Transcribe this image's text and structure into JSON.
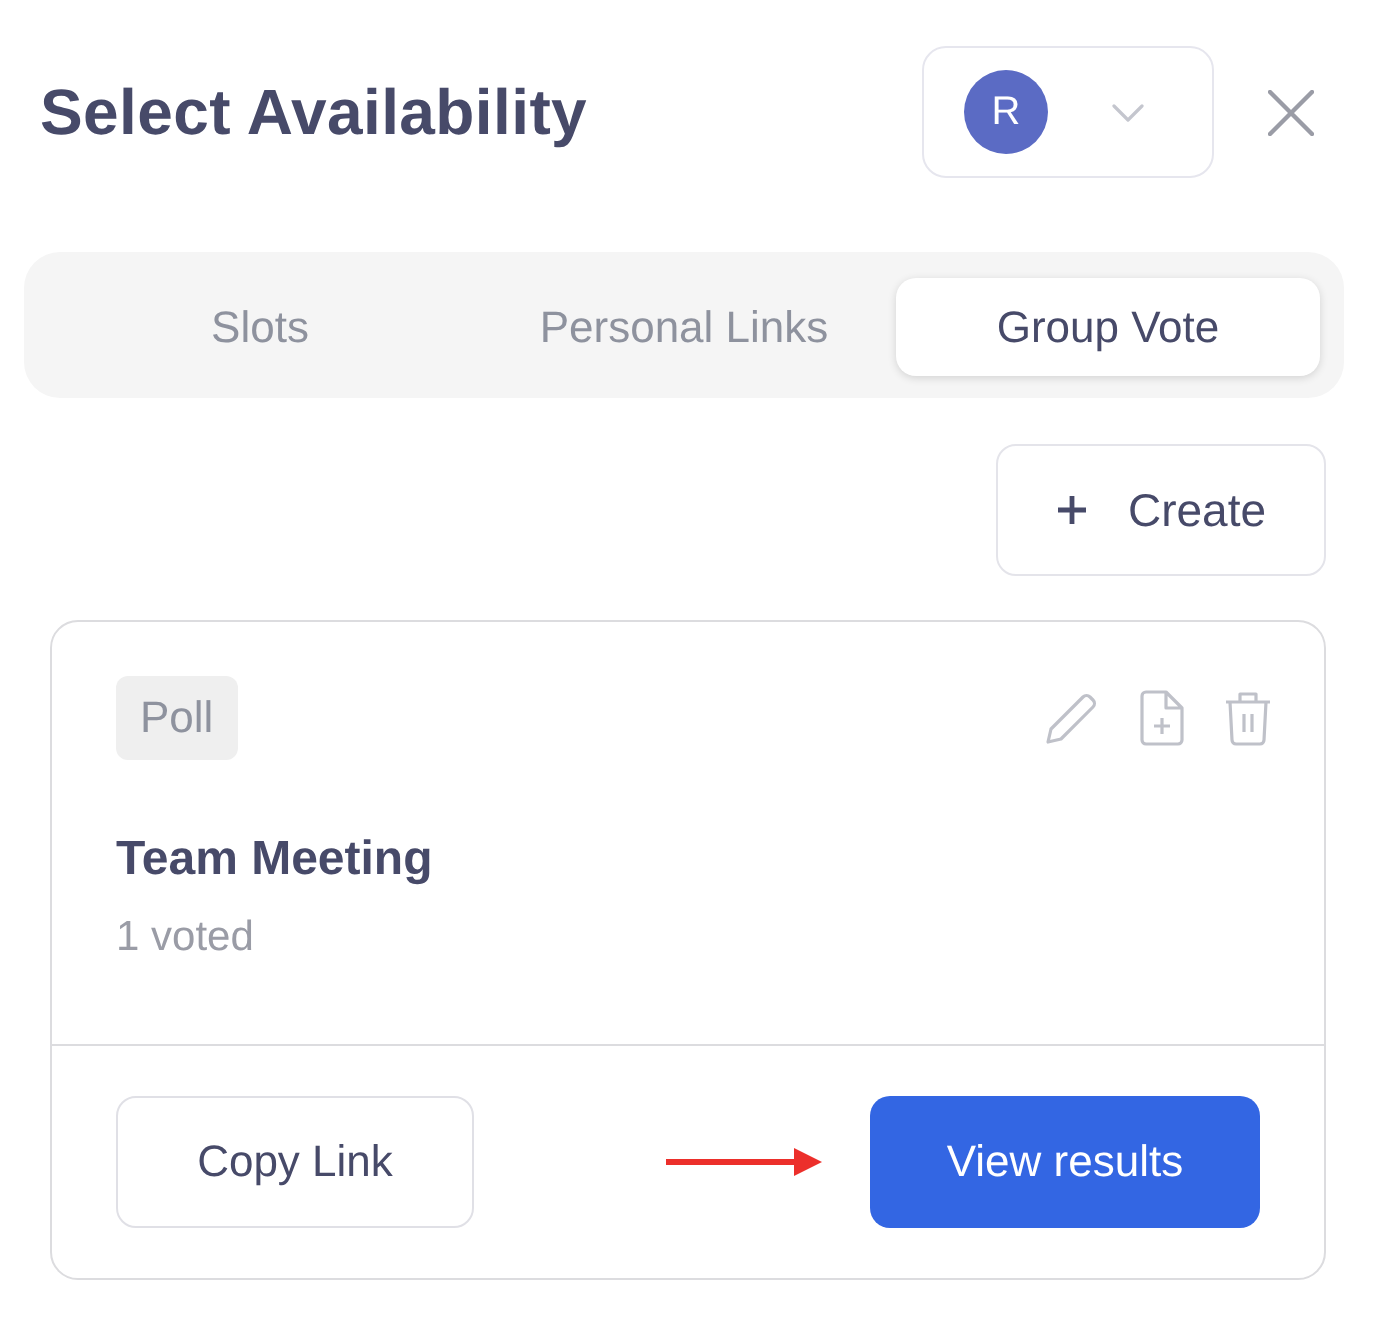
{
  "header": {
    "title": "Select Availability",
    "account": {
      "initial": "R"
    }
  },
  "tabs": [
    {
      "label": "Slots",
      "selected": false
    },
    {
      "label": "Personal Links",
      "selected": false
    },
    {
      "label": "Group Vote",
      "selected": true
    }
  ],
  "create_button": {
    "label": "Create"
  },
  "polls": [
    {
      "tag": "Poll",
      "title": "Team Meeting",
      "votes": "1 voted",
      "copy_button": "Copy Link",
      "view_button": "View results"
    }
  ]
}
